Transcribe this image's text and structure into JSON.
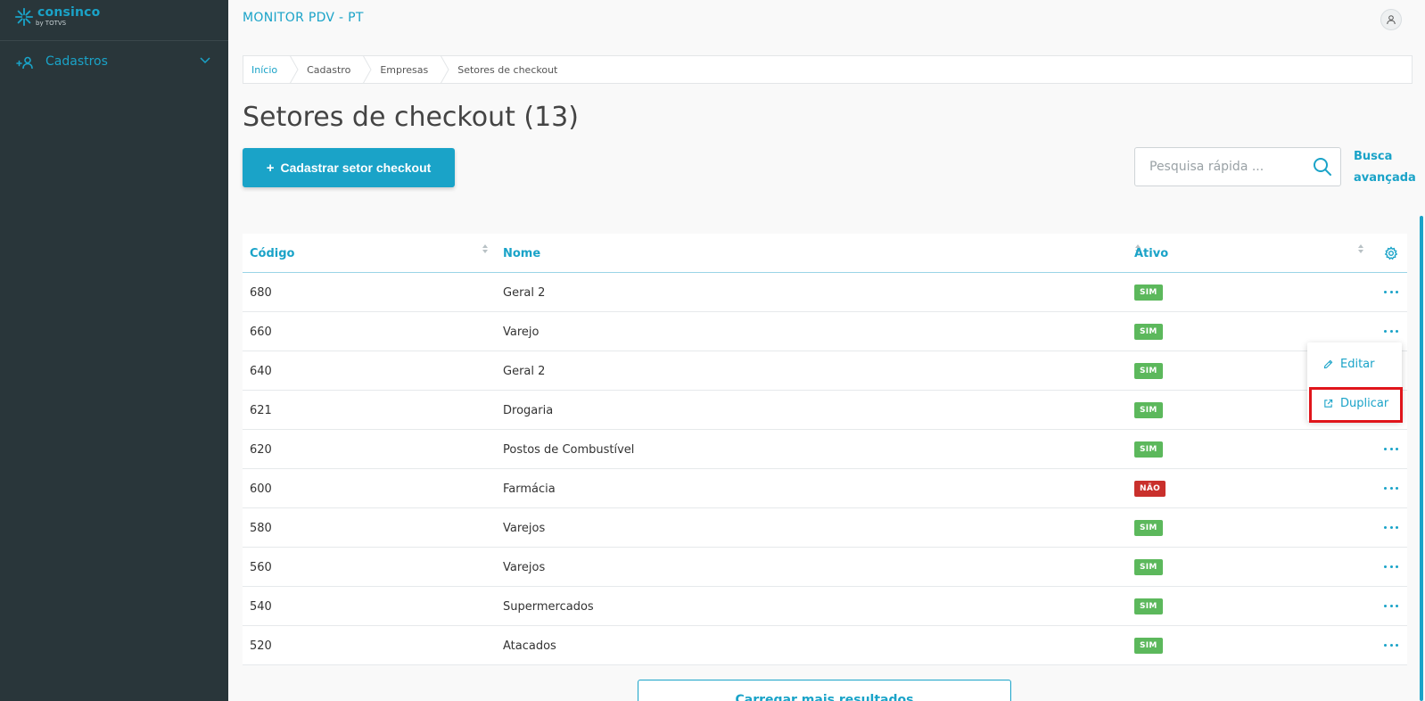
{
  "app": {
    "logo_text": "consinco",
    "logo_sub": "by TOTVS",
    "title": "MONITOR PDV - PT"
  },
  "sidebar": {
    "items": [
      {
        "label": "Cadastros",
        "icon": "add-user-icon"
      }
    ]
  },
  "breadcrumb": [
    "Início",
    "Cadastro",
    "Empresas",
    "Setores de checkout"
  ],
  "page": {
    "title": "Setores de checkout (13)",
    "primary_button": "Cadastrar setor checkout",
    "search_placeholder": "Pesquisa rápida ...",
    "advanced_search_line1": "Busca",
    "advanced_search_line2": "avançada",
    "load_more": "Carregar mais resultados"
  },
  "table": {
    "columns": [
      "Código",
      "Nome",
      "Ativo"
    ],
    "rows": [
      {
        "codigo": "680",
        "nome": "Geral 2",
        "ativo": "SIM"
      },
      {
        "codigo": "660",
        "nome": "Varejo",
        "ativo": "SIM"
      },
      {
        "codigo": "640",
        "nome": "Geral 2",
        "ativo": "SIM"
      },
      {
        "codigo": "621",
        "nome": "Drogaria",
        "ativo": "SIM"
      },
      {
        "codigo": "620",
        "nome": "Postos de Combustível",
        "ativo": "SIM"
      },
      {
        "codigo": "600",
        "nome": "Farmácia",
        "ativo": "NÃO"
      },
      {
        "codigo": "580",
        "nome": "Varejos",
        "ativo": "SIM"
      },
      {
        "codigo": "560",
        "nome": "Varejos",
        "ativo": "SIM"
      },
      {
        "codigo": "540",
        "nome": "Supermercados",
        "ativo": "SIM"
      },
      {
        "codigo": "520",
        "nome": "Atacados",
        "ativo": "SIM"
      }
    ]
  },
  "row_menu": {
    "items": [
      {
        "label": "Editar",
        "icon": "pencil-icon"
      },
      {
        "label": "Duplicar",
        "icon": "external-link-icon"
      }
    ]
  },
  "colors": {
    "accent": "#1aa3c8",
    "sidebar_bg": "#29363a",
    "badge_yes": "#5cb85c",
    "badge_no": "#c9302c",
    "highlight": "#e0151b"
  }
}
